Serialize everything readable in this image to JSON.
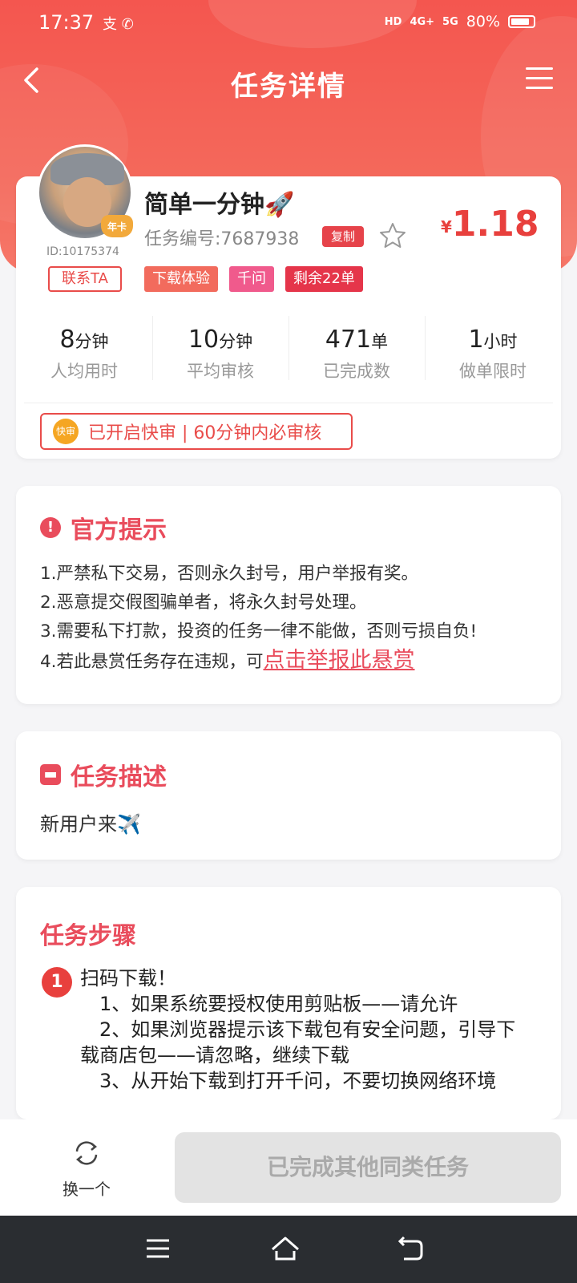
{
  "status_bar": {
    "time": "17:37",
    "left_icons": "支 ✆",
    "hd": "HD",
    "net1": "4G+",
    "net2": "5G",
    "battery": "80%"
  },
  "nav": {
    "title": "任务详情"
  },
  "task": {
    "user_id": "ID:10175374",
    "badge": "年卡",
    "contact_label": "联系TA",
    "title": "简单一分钟🚀",
    "task_no": "任务编号:7687938",
    "copy_label": "复制",
    "price_currency": "¥",
    "price": "1.18",
    "tags": [
      {
        "label": "下载体验",
        "color": "#f26b5d"
      },
      {
        "label": "千问",
        "color": "#f05a8c"
      },
      {
        "label": "剩余22单",
        "color": "#e5354a"
      }
    ],
    "stats": [
      {
        "value": "8",
        "unit": "分钟",
        "label": "人均用时"
      },
      {
        "value": "10",
        "unit": "分钟",
        "label": "平均审核"
      },
      {
        "value": "471",
        "unit": "单",
        "label": "已完成数"
      },
      {
        "value": "1",
        "unit": "小时",
        "label": "做单限时"
      }
    ],
    "fast_icon": "快审",
    "fast_text": "已开启快审 | 60分钟内必审核"
  },
  "tips": {
    "title": "官方提示",
    "items": [
      "1.严禁私下交易，否则永久封号，用户举报有奖。",
      "2.恶意提交假图骗单者，将永久封号处理。",
      "3.需要私下打款，投资的任务一律不能做，否则亏损自负!",
      "4.若此悬赏任务存在违规，可"
    ],
    "report_link": "点击举报此悬赏"
  },
  "description": {
    "title": "任务描述",
    "text": "新用户来✈️"
  },
  "steps": {
    "title": "任务步骤",
    "step1_num": "1",
    "step1_lines": [
      "扫码下载！",
      "　1、如果系统要授权使用剪贴板——请允许",
      "　2、如果浏览器提示该下载包有安全问题，引导下载商店包——请忽略，继续下载",
      "　3、从开始下载到打开千问，不要切换网络环境"
    ]
  },
  "action_bar": {
    "swap_label": "换一个",
    "done_label": "已完成其他同类任务"
  },
  "colors": {
    "header": "#f4564f",
    "accent": "#e94c4a",
    "pink": "#e94c5c"
  }
}
